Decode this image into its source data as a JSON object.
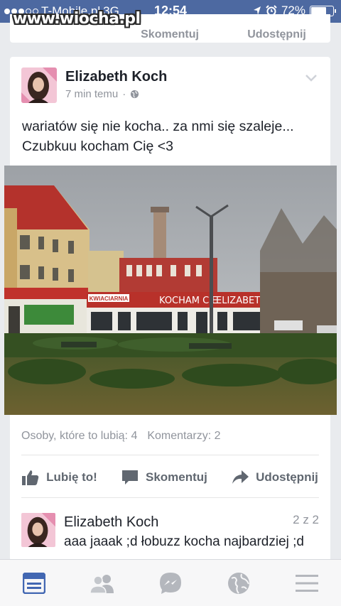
{
  "watermark": "www.wiocha.pl",
  "status_bar": {
    "carrier": "T-Mobile.pl",
    "network": "3G",
    "time": "12:54",
    "battery": "72%",
    "battery_level": 0.72
  },
  "previous_post": {
    "actions": [
      "Skomentuj",
      "Udostępnij"
    ]
  },
  "post": {
    "author": "Elizabeth Koch",
    "time_ago": "7 min temu",
    "privacy_icon": "globe-icon",
    "text_line1": "wariatów się nie kocha.. za nmi się szaleje...",
    "text_line2": "Czubkuu kocham Cię <3",
    "photo_signs": {
      "shop": "KWIACIARNIA",
      "graffiti1": "KOCHAM CIE",
      "graffiti2": "ELIZABETH"
    },
    "likes_label": "Osoby, które to lubią: 4",
    "comments_label": "Komentarzy: 2",
    "actions": {
      "like": "Lubię to!",
      "comment": "Skomentuj",
      "share": "Udostępnij"
    }
  },
  "comment": {
    "author": "Elizabeth Koch",
    "counter": "2 z 2",
    "text": "aaa jaaak ;d łobuzz kocha najbardziej ;d"
  },
  "tabbar": {
    "items": [
      "news-feed-icon",
      "friends-icon",
      "messenger-icon",
      "globe-icon",
      "menu-icon"
    ],
    "active_color": "#4267b2",
    "inactive_color": "#b4b7bd"
  }
}
